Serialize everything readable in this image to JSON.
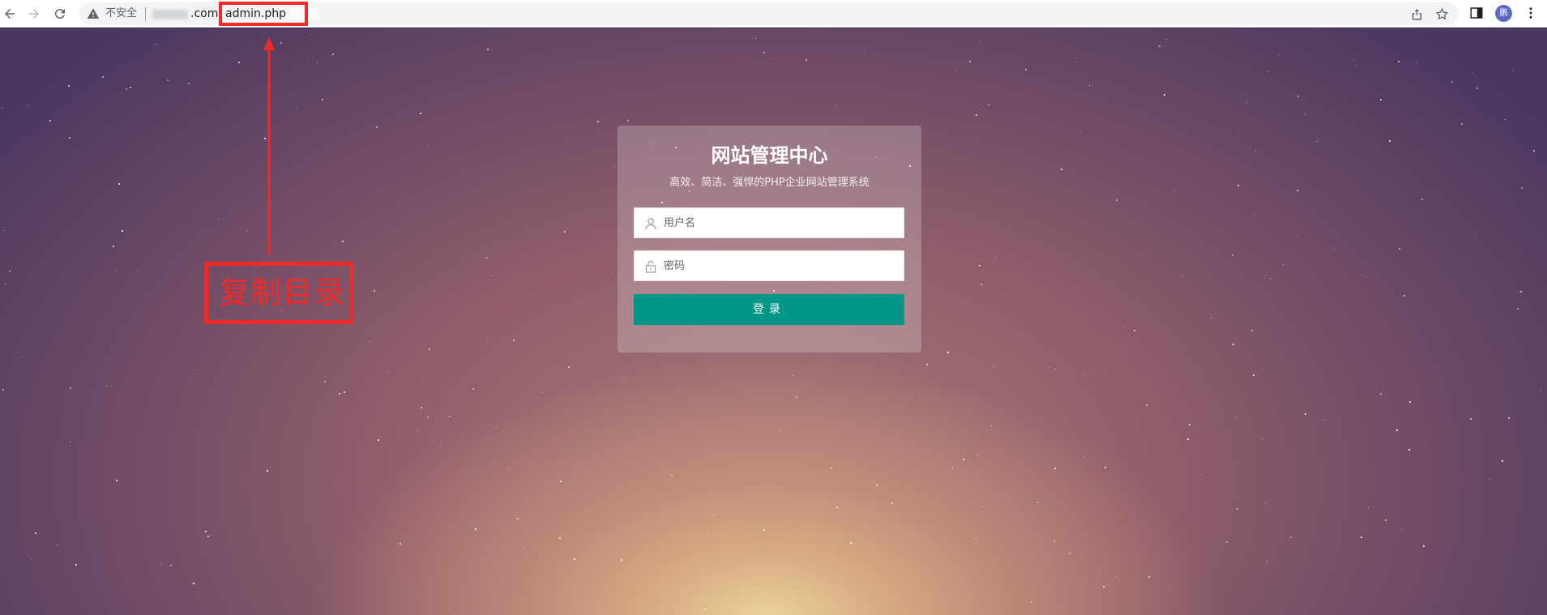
{
  "browser": {
    "security_label": "不安全",
    "domain_suffix": ".com",
    "url_path": "admin.php",
    "avatar_text": "鹏"
  },
  "annotation": {
    "label": "复制目录",
    "color": "#ee2b2b"
  },
  "login": {
    "title": "网站管理中心",
    "subtitle": "高效、简洁、强悍的PHP企业网站管理系统",
    "username_placeholder": "用户名",
    "password_placeholder": "密码",
    "submit_label": "登录",
    "accent": "#009688"
  }
}
